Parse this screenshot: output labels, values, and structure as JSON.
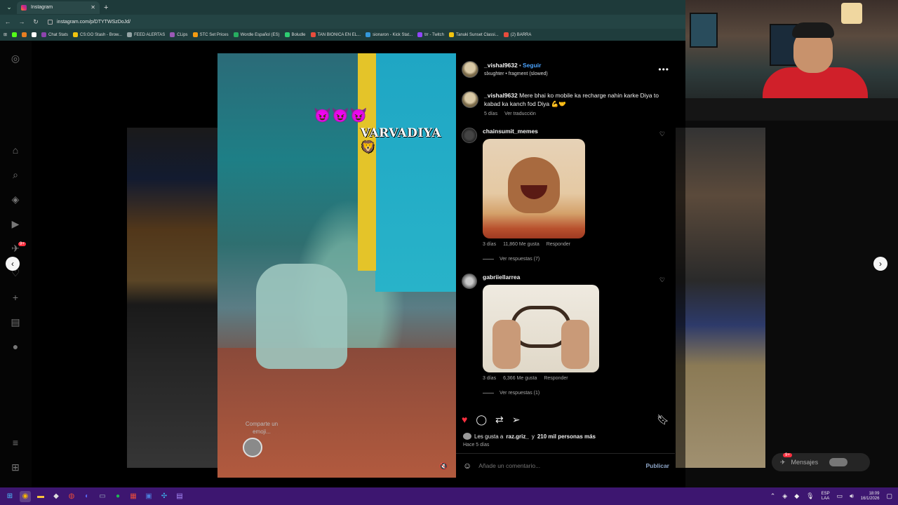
{
  "browser": {
    "tab_title": "Instagram",
    "url": "instagram.com/p/DTYTWSzDoJd/",
    "bookmarks": [
      {
        "label": "Chat Stats",
        "color": "#8e44ad"
      },
      {
        "label": "CS:GO Stash - Brow...",
        "color": "#f1c40f"
      },
      {
        "label": "FEED ALERTAS",
        "color": "#95a5a6"
      },
      {
        "label": "CLips",
        "color": "#9b59b6"
      },
      {
        "label": "STC Set Prices",
        "color": "#f39c12"
      },
      {
        "label": "Wordle Español (ES)",
        "color": "#27ae60"
      },
      {
        "label": "Boludle",
        "color": "#2ecc71"
      },
      {
        "label": "TAN BIONICA EN EL...",
        "color": "#e74c3c"
      },
      {
        "label": "sionaron - Kick Stat...",
        "color": "#3498db"
      },
      {
        "label": "trr - Twitch",
        "color": "#9146ff"
      },
      {
        "label": "Tanuki Sunset Classi...",
        "color": "#f1c40f"
      },
      {
        "label": "(2) BARRA",
        "color": "#e74c3c"
      }
    ]
  },
  "post": {
    "author": "_vishal9632",
    "follow_label": "Seguir",
    "audio": "slxughter • fragment (slowed)",
    "overlay_text": "VARVADIYA🦁",
    "overlay_emoji": "😈😈😈",
    "share_emoji_label": "Comparte un emoji...",
    "caption": {
      "username": "_vishal9632",
      "text": "Mere bhai ko mobile ka recharge nahin karke Diya to kabad ka kanch fod Diya 💪🤝",
      "time": "5 días",
      "translate": "Ver traducción"
    },
    "comments": [
      {
        "username": "chainsumit_memes",
        "time": "3 días",
        "likes": "11,860 Me gusta",
        "reply": "Responder",
        "view_replies": "Ver respuestas (7)"
      },
      {
        "username": "gabriiellarrea",
        "time": "3 días",
        "likes": "6,366 Me gusta",
        "reply": "Responder",
        "view_replies": "Ver respuestas (1)"
      }
    ],
    "likes_prefix": "Les gusta a",
    "likes_user": "raz.griz_",
    "likes_mid": "y",
    "likes_rest": "210 mil personas más",
    "posted_ago": "Hace 5 días",
    "comment_placeholder": "Añade un comentario...",
    "publish_label": "Publicar"
  },
  "messages": {
    "label": "Mensajes",
    "badge": "9+"
  },
  "sidebar_badge": "9+",
  "taskbar": {
    "lang_line1": "ESP",
    "lang_line2": "LAA",
    "time": "18:09",
    "date": "16/1/2026"
  },
  "icons": {
    "like": "heart-filled-icon",
    "comment": "comment-bubble-icon",
    "repost": "repost-icon",
    "share": "paper-plane-icon",
    "save": "bookmark-icon",
    "more": "ellipsis-icon",
    "emoji": "smiley-icon"
  },
  "colors": {
    "like_red": "#ff3040",
    "follow_blue": "#4aa3ff",
    "taskbar": "#3d1670",
    "browser_chrome": "#1e3a3a"
  }
}
